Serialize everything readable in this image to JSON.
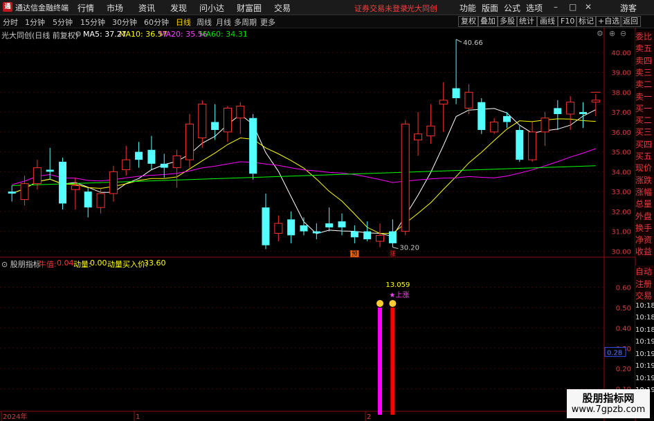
{
  "titlebar": {
    "app_name": "通达信金融终端",
    "menus": [
      "行情",
      "市场",
      "资讯",
      "发现",
      "问小达",
      "财富圈",
      "交易"
    ],
    "warning": "证券交易未登录",
    "stock_title": "光大同创",
    "right_menus": [
      "功能",
      "版面",
      "公式",
      "选项"
    ],
    "user": "游客"
  },
  "toolbar": {
    "periods": [
      "分时",
      "1分钟",
      "5分钟",
      "15分钟",
      "30分钟",
      "60分钟",
      "日线",
      "周线",
      "月线",
      "多周期",
      "更多"
    ],
    "active_period": "日线",
    "buttons": [
      "复权",
      "叠加",
      "多股",
      "统计",
      "画线",
      "F10",
      "标记",
      "+自选",
      "返回"
    ]
  },
  "main_legend": {
    "stock": "光大同创(日线 前复权)",
    "ma5": "MA5: 37.27",
    "ma10": "MA10: 36.57",
    "ma20": "MA20: 35.56",
    "ma60": "MA60: 34.31",
    "colors": {
      "ma5": "#ffffff",
      "ma10": "#ffff00",
      "ma20": "#ff00ff",
      "ma60": "#00ff00"
    }
  },
  "sub_legend": {
    "name": "股朋指标",
    "cow_label": "牛值:",
    "cow_value": "0.04",
    "mom_label": "动量:",
    "mom_value": "0.00",
    "buy_label": "动量买入价:",
    "buy_value": "33.60"
  },
  "right_axis_main": [
    "40.00",
    "39.00",
    "38.00",
    "37.00",
    "36.00",
    "35.00",
    "34.00",
    "33.00",
    "32.00",
    "31.00",
    "30.00"
  ],
  "right_axis_sub": [
    "0.60",
    "0.50",
    "0.40",
    "0.30",
    "0.20",
    "0.10"
  ],
  "current_marker": "0.28",
  "side_panel": [
    "委比",
    "卖五",
    "卖四",
    "卖三",
    "卖二",
    "卖一",
    "买一",
    "买二",
    "买三",
    "买四",
    "买五",
    "现价",
    "涨跌",
    "涨幅",
    "总量",
    "外盘",
    "换手",
    "净资",
    "收益"
  ],
  "side_panel_sub": [
    "自动",
    "注册",
    "交易",
    "10:18",
    "10:18",
    "10:18",
    "10:19",
    "10:19",
    "10:19",
    "10:19",
    "10:19"
  ],
  "annotations": {
    "high": "40.66",
    "low": "30.20",
    "sub_peak": "13.059",
    "up_signal": "★上涨",
    "tag1": "预",
    "tag2": "涨"
  },
  "xaxis": {
    "year": "2024年",
    "m1": "1",
    "m2": "2"
  },
  "watermark": {
    "line1": "股朋指标网",
    "line2": "www.7gpzb.com"
  },
  "chart_data": {
    "type": "candlestick",
    "ylim": [
      29.7,
      40.9
    ],
    "candles": [
      {
        "o": 33.0,
        "h": 33.3,
        "l": 32.5,
        "c": 32.9
      },
      {
        "o": 32.6,
        "h": 33.8,
        "l": 32.3,
        "c": 33.4
      },
      {
        "o": 33.4,
        "h": 34.6,
        "l": 33.1,
        "c": 34.2
      },
      {
        "o": 34.1,
        "h": 35.2,
        "l": 33.6,
        "c": 34.0
      },
      {
        "o": 34.5,
        "h": 34.7,
        "l": 32.1,
        "c": 32.4
      },
      {
        "o": 33.1,
        "h": 33.7,
        "l": 32.1,
        "c": 33.3
      },
      {
        "o": 33.0,
        "h": 33.2,
        "l": 31.7,
        "c": 32.2
      },
      {
        "o": 32.2,
        "h": 33.2,
        "l": 31.9,
        "c": 32.9
      },
      {
        "o": 32.9,
        "h": 34.3,
        "l": 32.5,
        "c": 34.0
      },
      {
        "o": 34.1,
        "h": 35.3,
        "l": 33.8,
        "c": 34.6
      },
      {
        "o": 35.0,
        "h": 35.5,
        "l": 34.2,
        "c": 34.6
      },
      {
        "o": 35.1,
        "h": 35.8,
        "l": 34.1,
        "c": 34.4
      },
      {
        "o": 34.4,
        "h": 34.9,
        "l": 33.7,
        "c": 34.2
      },
      {
        "o": 34.2,
        "h": 35.1,
        "l": 33.2,
        "c": 34.8
      },
      {
        "o": 34.6,
        "h": 36.9,
        "l": 34.2,
        "c": 36.4
      },
      {
        "o": 35.7,
        "h": 37.6,
        "l": 35.2,
        "c": 37.4
      },
      {
        "o": 36.5,
        "h": 37.4,
        "l": 35.6,
        "c": 36.1
      },
      {
        "o": 36.0,
        "h": 37.3,
        "l": 35.5,
        "c": 37.2
      },
      {
        "o": 36.7,
        "h": 37.5,
        "l": 35.9,
        "c": 37.3
      },
      {
        "o": 36.7,
        "h": 36.9,
        "l": 33.6,
        "c": 33.9
      },
      {
        "o": 32.2,
        "h": 32.9,
        "l": 30.1,
        "c": 30.3
      },
      {
        "o": 30.9,
        "h": 31.8,
        "l": 30.5,
        "c": 31.4
      },
      {
        "o": 31.6,
        "h": 32.0,
        "l": 30.4,
        "c": 30.8
      },
      {
        "o": 31.3,
        "h": 31.7,
        "l": 30.8,
        "c": 31.0
      },
      {
        "o": 31.0,
        "h": 31.4,
        "l": 30.6,
        "c": 30.9
      },
      {
        "o": 31.4,
        "h": 32.2,
        "l": 31.0,
        "c": 31.2
      },
      {
        "o": 31.5,
        "h": 31.9,
        "l": 30.8,
        "c": 31.2
      },
      {
        "o": 31.0,
        "h": 31.3,
        "l": 30.4,
        "c": 30.7
      },
      {
        "o": 31.0,
        "h": 31.5,
        "l": 30.5,
        "c": 30.6
      },
      {
        "o": 30.5,
        "h": 31.4,
        "l": 30.2,
        "c": 30.8
      },
      {
        "o": 31.0,
        "h": 31.6,
        "l": 30.2,
        "c": 30.4
      },
      {
        "o": 31.0,
        "h": 36.6,
        "l": 30.8,
        "c": 36.4
      },
      {
        "o": 35.6,
        "h": 37.0,
        "l": 34.8,
        "c": 35.9
      },
      {
        "o": 35.8,
        "h": 37.4,
        "l": 35.4,
        "c": 36.3
      },
      {
        "o": 37.4,
        "h": 38.5,
        "l": 36.0,
        "c": 37.6
      },
      {
        "o": 38.2,
        "h": 40.66,
        "l": 37.4,
        "c": 37.7
      },
      {
        "o": 37.2,
        "h": 38.4,
        "l": 36.9,
        "c": 38.0
      },
      {
        "o": 37.5,
        "h": 37.7,
        "l": 35.9,
        "c": 36.1
      },
      {
        "o": 36.0,
        "h": 36.7,
        "l": 35.9,
        "c": 36.5
      },
      {
        "o": 36.8,
        "h": 37.0,
        "l": 36.2,
        "c": 36.5
      },
      {
        "o": 36.1,
        "h": 36.3,
        "l": 34.5,
        "c": 34.6
      },
      {
        "o": 34.6,
        "h": 36.5,
        "l": 34.5,
        "c": 36.0
      },
      {
        "o": 36.0,
        "h": 37.0,
        "l": 35.3,
        "c": 36.7
      },
      {
        "o": 37.2,
        "h": 37.6,
        "l": 36.1,
        "c": 36.9
      },
      {
        "o": 36.9,
        "h": 37.8,
        "l": 36.1,
        "c": 37.5
      },
      {
        "o": 37.0,
        "h": 37.5,
        "l": 36.2,
        "c": 36.9
      },
      {
        "o": 37.5,
        "h": 37.9,
        "l": 36.8,
        "c": 37.6
      }
    ],
    "sub_bars": [
      {
        "index": 29,
        "value": 0.5,
        "color": "#ff00ff"
      },
      {
        "index": 30,
        "value": 0.5,
        "color": "#ff0000"
      }
    ],
    "sub_ylim": [
      0.0,
      0.68
    ]
  }
}
